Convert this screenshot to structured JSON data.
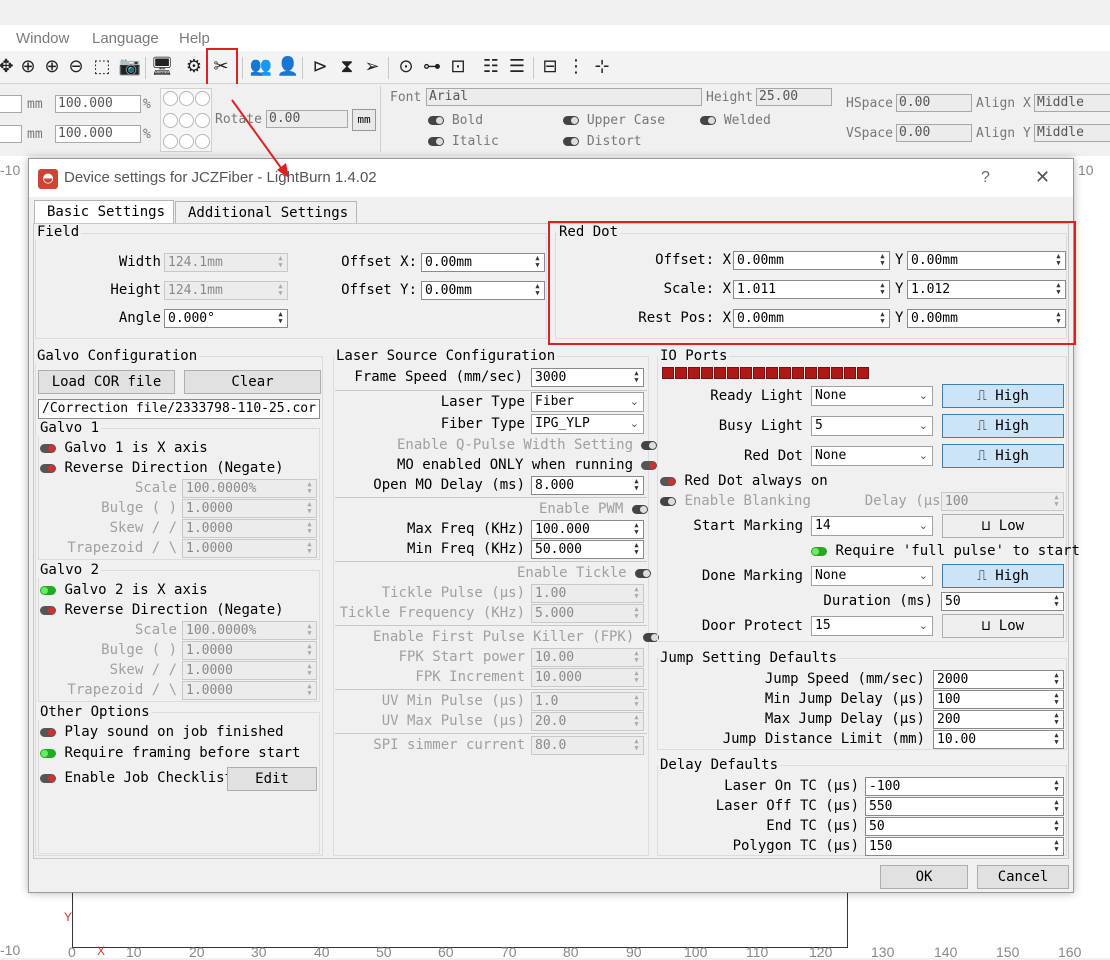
{
  "menu": {
    "items": [
      "Window",
      "Language",
      "Help"
    ]
  },
  "propbar": {
    "row1_val1": "",
    "row1_unit": "mm",
    "row1_pct": "100.000",
    "row1_pct_unit": "%",
    "row2_unit": "mm",
    "row2_pct": "100.000",
    "row2_pct_unit": "%",
    "rotate_label": "Rotate",
    "rotate_value": "0.00",
    "mm_button": "mm",
    "font_label": "Font",
    "font_value": "Arial",
    "height_label": "Height",
    "height_value": "25.00",
    "hspace_label": "HSpace",
    "hspace_value": "0.00",
    "vspace_label": "VSpace",
    "vspace_value": "0.00",
    "alignx_label": "Align X",
    "alignx_value": "Middle",
    "aligny_label": "Align Y",
    "aligny_value": "Middle",
    "bold": "Bold",
    "italic": "Italic",
    "upper_case": "Upper Case",
    "distort": "Distort",
    "welded": "Welded"
  },
  "rulers": {
    "left_top": "-10",
    "right_top": "10",
    "left_bottom": "-10",
    "y_label": "Y",
    "x_label": "X",
    "bottom": [
      "0",
      "10",
      "20",
      "30",
      "40",
      "50",
      "60",
      "70",
      "80",
      "90",
      "100",
      "110",
      "120",
      "130",
      "140",
      "150",
      "160"
    ]
  },
  "dialog": {
    "title": "Device settings for JCZFiber - LightBurn 1.4.02",
    "help": "?",
    "close": "✕",
    "tabs": [
      "Basic Settings",
      "Additional Settings"
    ],
    "field": {
      "title": "Field",
      "width_label": "Width",
      "width": "124.1mm",
      "height_label": "Height",
      "height": "124.1mm",
      "angle_label": "Angle",
      "angle": "0.000°",
      "offx_label": "Offset X:",
      "offx": "0.00mm",
      "offy_label": "Offset Y:",
      "offy": "0.00mm"
    },
    "reddot": {
      "title": "Red Dot",
      "offset_label": "Offset: X",
      "offset_x": "0.00mm",
      "offset_y": "0.00mm",
      "scale_label": "Scale: X",
      "scale_x": "1.011",
      "scale_y": "1.012",
      "rest_label": "Rest Pos: X",
      "rest_x": "0.00mm",
      "rest_y": "0.00mm",
      "y": "Y"
    },
    "galvo": {
      "title": "Galvo Configuration",
      "load_cor": "Load COR file",
      "clear": "Clear",
      "cor_path": "/Correction file/2333798-110-25.cor",
      "g1": {
        "title": "Galvo 1",
        "xaxis": "Galvo 1 is X axis",
        "reverse": "Reverse Direction (Negate)",
        "scale_l": "Scale",
        "scale": "100.0000%",
        "bulge_l": "Bulge (  )",
        "bulge": "1.0000",
        "skew_l": "Skew  / /",
        "skew": "1.0000",
        "trap_l": "Trapezoid  / \\",
        "trap": "1.0000"
      },
      "g2": {
        "title": "Galvo 2",
        "xaxis": "Galvo 2 is X axis",
        "reverse": "Reverse Direction (Negate)",
        "scale_l": "Scale",
        "scale": "100.0000%",
        "bulge_l": "Bulge (  )",
        "bulge": "1.0000",
        "skew_l": "Skew  / /",
        "skew": "1.0000",
        "trap_l": "Trapezoid  / \\",
        "trap": "1.0000"
      }
    },
    "other": {
      "title": "Other Options",
      "play_sound": "Play sound on job finished",
      "require_framing": "Require framing before start",
      "checklist": "Enable Job Checklist",
      "edit": "Edit"
    },
    "laser": {
      "title": "Laser Source Configuration",
      "frame_speed_l": "Frame Speed (mm/sec)",
      "frame_speed": "3000",
      "laser_type_l": "Laser Type",
      "laser_type": "Fiber",
      "fiber_type_l": "Fiber Type",
      "fiber_type": "IPG_YLP",
      "qpulse": "Enable Q-Pulse Width Setting",
      "mo_enabled": "MO enabled ONLY when running",
      "open_mo_l": "Open MO Delay (ms)",
      "open_mo": "8.000",
      "pwm": "Enable PWM",
      "maxf_l": "Max Freq (KHz)",
      "maxf": "100.000",
      "minf_l": "Min Freq (KHz)",
      "minf": "50.000",
      "tickle": "Enable Tickle",
      "tickle_pulse_l": "Tickle Pulse (μs)",
      "tickle_pulse": "1.00",
      "tickle_freq_l": "Tickle Frequency (KHz)",
      "tickle_freq": "5.000",
      "fpk": "Enable First Pulse Killer (FPK)",
      "fpk_start_l": "FPK Start power",
      "fpk_start": "10.00",
      "fpk_inc_l": "FPK Increment",
      "fpk_inc": "10.000",
      "uvmin_l": "UV Min Pulse (μs)",
      "uvmin": "1.0",
      "uvmax_l": "UV Max Pulse (μs)",
      "uvmax": "20.0",
      "spi_l": "SPI simmer current",
      "spi": "80.0"
    },
    "io": {
      "title": "IO Ports",
      "ready_l": "Ready Light",
      "ready": "None",
      "busy_l": "Busy Light",
      "busy": "5",
      "reddot_l": "Red Dot",
      "reddot": "None",
      "high": "High",
      "low": "Low",
      "reddot_always": "Red Dot always on",
      "blanking": "Enable Blanking",
      "delay_l": "Delay (μs)",
      "delay": "100",
      "start_l": "Start Marking",
      "start": "14",
      "require_full": "Require 'full pulse' to start",
      "done_l": "Done Marking",
      "done": "None",
      "duration_l": "Duration (ms)",
      "duration": "50",
      "door_l": "Door Protect",
      "door": "15"
    },
    "jump": {
      "title": "Jump Setting Defaults",
      "speed_l": "Jump Speed (mm/sec)",
      "speed": "2000",
      "min_l": "Min Jump Delay (μs)",
      "min": "100",
      "max_l": "Max Jump Delay (μs)",
      "max": "200",
      "limit_l": "Jump Distance Limit (mm)",
      "limit": "10.00"
    },
    "delay": {
      "title": "Delay Defaults",
      "on_l": "Laser On TC (μs)",
      "on": "-100",
      "off_l": "Laser Off TC (μs)",
      "off": "550",
      "end_l": "End TC (μs)",
      "end": "50",
      "poly_l": "Polygon TC (μs)",
      "poly": "150"
    },
    "ok": "OK",
    "cancel": "Cancel"
  }
}
